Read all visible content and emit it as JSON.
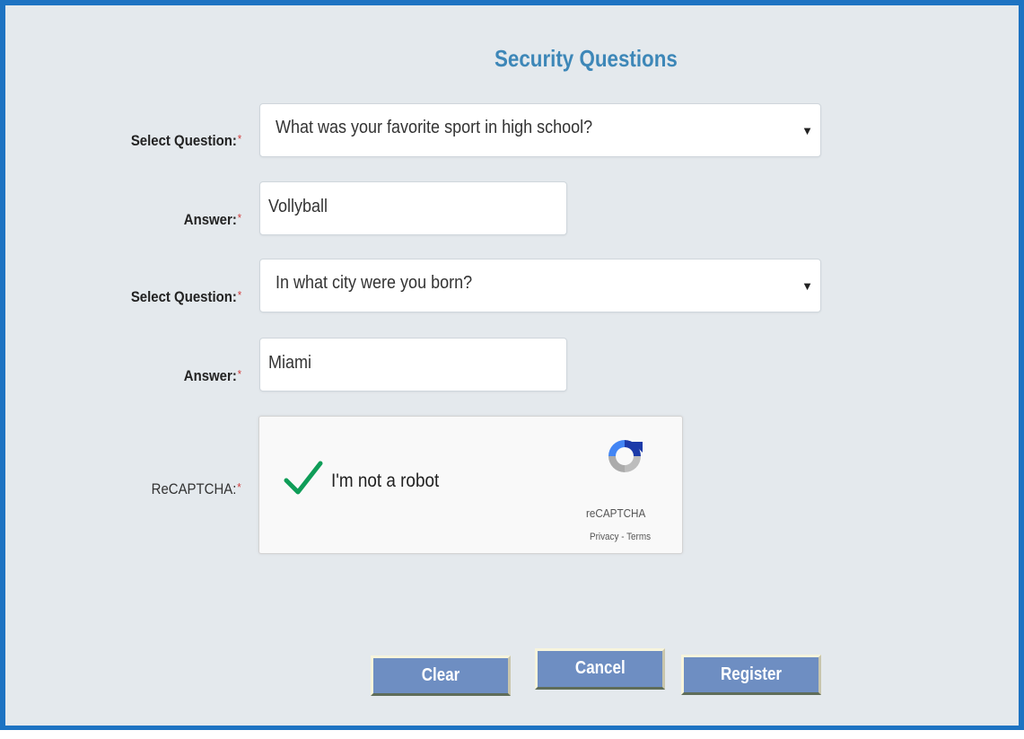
{
  "form": {
    "title": "Security Questions",
    "question1": {
      "label": "Select Question:",
      "selected": "What was your favorite sport in high school?"
    },
    "answer1": {
      "label": "Answer:",
      "value": "Vollyball"
    },
    "question2": {
      "label": "Select Question:",
      "selected": "In what city were you born?"
    },
    "answer2": {
      "label": "Answer:",
      "value": "Miami"
    },
    "captcha": {
      "label": "ReCAPTCHA:",
      "checkbox_label": "I'm not a robot",
      "brand": "reCAPTCHA",
      "links": "Privacy - Terms",
      "checked": true
    },
    "required_marker": "*",
    "buttons": {
      "clear": "Clear",
      "cancel": "Cancel",
      "register": "Register"
    }
  },
  "colors": {
    "frame_border": "#1d73c2",
    "background": "#e4e9ed",
    "title": "#3d87b8",
    "button": "#6e8ec2",
    "required": "#d23b3b",
    "checkmark": "#0f9d58"
  },
  "icons": {
    "dropdown": "chevron-down-icon",
    "check": "checkmark-icon",
    "captcha_logo": "recaptcha-logo-icon"
  }
}
